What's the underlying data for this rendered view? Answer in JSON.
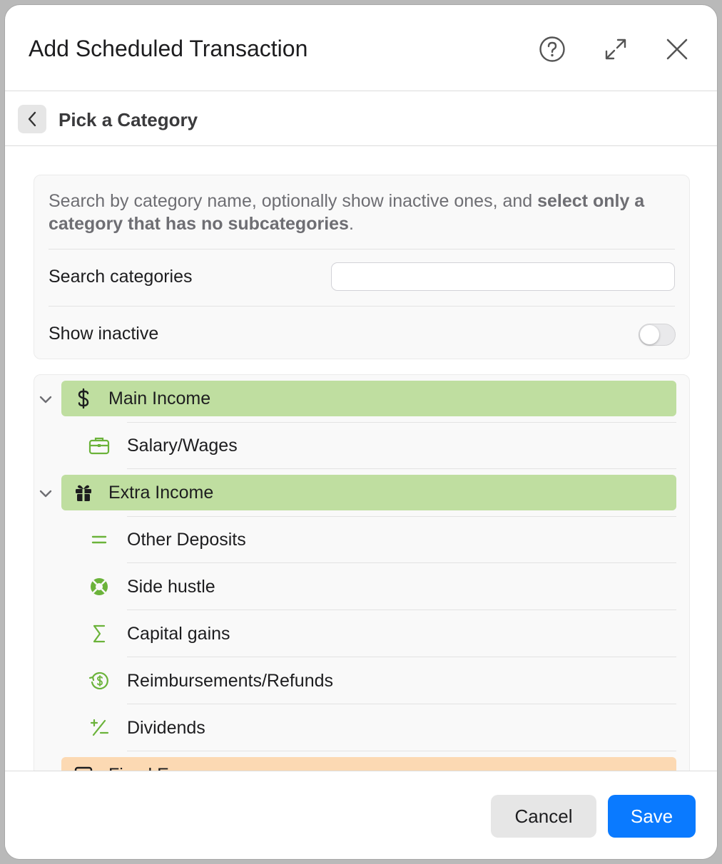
{
  "window": {
    "title": "Add Scheduled Transaction",
    "icons": [
      "help-icon",
      "expand-icon",
      "close-icon"
    ]
  },
  "subheader": {
    "title": "Pick a Category",
    "back_icon": "chevron-left-icon"
  },
  "filters": {
    "description_plain": "Search by category name, optionally show inactive ones, and ",
    "description_bold": "select only a category that has no subcategories",
    "description_end": ".",
    "search_label": "Search categories",
    "search_value": "",
    "show_inactive_label": "Show inactive",
    "show_inactive_on": false
  },
  "tree": {
    "groups": [
      {
        "label": "Main Income",
        "icon": "dollar-icon",
        "color": "#bfdea0",
        "expanded": true,
        "children": [
          {
            "label": "Salary/Wages",
            "icon": "briefcase-icon"
          }
        ]
      },
      {
        "label": "Extra Income",
        "icon": "gift-icon",
        "color": "#bfdea0",
        "expanded": true,
        "children": [
          {
            "label": "Other Deposits",
            "icon": "equals-icon"
          },
          {
            "label": "Side hustle",
            "icon": "lifebuoy-icon"
          },
          {
            "label": "Capital gains",
            "icon": "sigma-icon"
          },
          {
            "label": "Reimbursements/Refunds",
            "icon": "refund-dollar-icon"
          },
          {
            "label": "Dividends",
            "icon": "plus-minus-icon"
          }
        ]
      },
      {
        "label": "Fixed E",
        "icon": "calendar-icon",
        "color": "#fcd9b3",
        "expanded": true,
        "children": []
      }
    ]
  },
  "footer": {
    "cancel_label": "Cancel",
    "save_label": "Save"
  },
  "colors": {
    "accent": "#0a7aff",
    "icon_green": "#6bb33a",
    "income_group": "#bfdea0",
    "expense_group": "#fcd9b3"
  }
}
